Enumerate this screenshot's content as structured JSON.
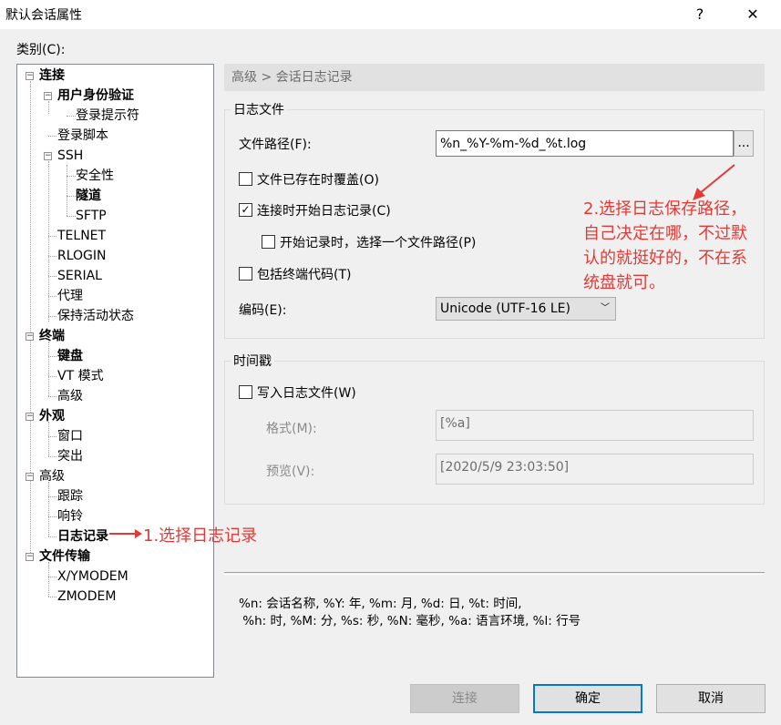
{
  "window": {
    "title": "默认会话属性",
    "help": "?",
    "close": "✕"
  },
  "category_label": "类别(C):",
  "tree": {
    "connection": "连接",
    "auth": "用户身份验证",
    "login_prompt": "登录提示符",
    "login_script": "登录脚本",
    "ssh": "SSH",
    "security": "安全性",
    "tunnel": "隧道",
    "sftp": "SFTP",
    "telnet": "TELNET",
    "rlogin": "RLOGIN",
    "serial": "SERIAL",
    "proxy": "代理",
    "keepalive": "保持活动状态",
    "terminal": "终端",
    "keyboard": "键盘",
    "vt_mode": "VT 模式",
    "terminal_advanced": "高级",
    "appearance": "外观",
    "window": "窗口",
    "highlight": "突出",
    "advanced": "高级",
    "trace": "跟踪",
    "bell": "响铃",
    "logging": "日志记录",
    "file_transfer": "文件传输",
    "xymodem": "X/YMODEM",
    "zmodem": "ZMODEM"
  },
  "breadcrumb": "高级 > 会话日志记录",
  "log_file": {
    "group_title": "日志文件",
    "path_label": "文件路径(F):",
    "path_value": "%n_%Y-%m-%d_%t.log",
    "browse": "...",
    "overwrite_label": "文件已存在时覆盖(O)",
    "start_on_connect_label": "连接时开始日志记录(C)",
    "choose_path_label": "开始记录时，选择一个文件路径(P)",
    "include_terminal_codes_label": "包括终端代码(T)",
    "encoding_label": "编码(E):",
    "encoding_value": "Unicode (UTF-16 LE)"
  },
  "timestamp": {
    "group_title": "时间戳",
    "write_label": "写入日志文件(W)",
    "format_label": "格式(M):",
    "format_value": "[%a]",
    "preview_label": "预览(V):",
    "preview_value": "[2020/5/9 23:03:50]"
  },
  "help_text": {
    "line1": "%n: 会话名称, %Y: 年, %m: 月, %d: 日, %t: 时间,",
    "line2": " %h: 时, %M: 分, %s: 秒, %N: 毫秒, %a: 语言环境, %l: 行号"
  },
  "buttons": {
    "connect": "连接",
    "ok": "确定",
    "cancel": "取消"
  },
  "annotations": {
    "a1": "1.选择日志记录",
    "a2_l1": "2.选择日志保存路径，",
    "a2_l2": "自己决定在哪，不过默",
    "a2_l3": "认的就挺好的，不在系",
    "a2_l4": "统盘就可。"
  },
  "colors": {
    "annotation": "#e53935",
    "accent": "#0078d7"
  }
}
